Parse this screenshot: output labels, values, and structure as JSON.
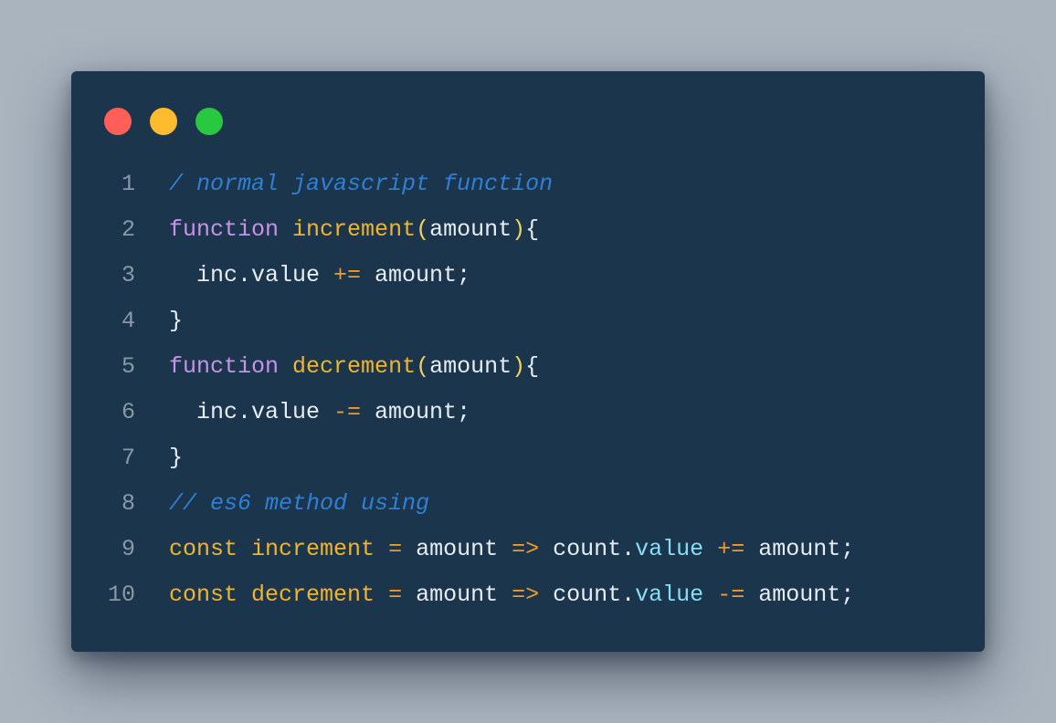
{
  "colors": {
    "page_background": "#a9b4bf",
    "window_background": "#1b364c",
    "close_dot": "#ff5f57",
    "minimize_dot": "#fdbc2e",
    "maximize_dot": "#28c840",
    "line_number": "#8a99a6",
    "comment": "#2f7fd6",
    "keyword": "#c792ea",
    "function_name": "#f0b52c",
    "operator": "#f19a2b",
    "paren": "#f0d264",
    "property": "#89ddf5",
    "plain": "#e6edf3"
  },
  "window_controls": [
    "close-dot",
    "minimize-dot",
    "maximize-dot"
  ],
  "code": {
    "language": "javascript",
    "lines": [
      {
        "number": "1",
        "tokens": [
          {
            "text": "/ normal javascript function",
            "type": "comment"
          }
        ]
      },
      {
        "number": "2",
        "tokens": [
          {
            "text": "function",
            "type": "keyword"
          },
          {
            "text": " ",
            "type": "plain"
          },
          {
            "text": "increment",
            "type": "fn"
          },
          {
            "text": "(",
            "type": "paren"
          },
          {
            "text": "amount",
            "type": "plain"
          },
          {
            "text": ")",
            "type": "paren"
          },
          {
            "text": "{",
            "type": "plain"
          }
        ]
      },
      {
        "number": "3",
        "tokens": [
          {
            "text": "  inc.value ",
            "type": "plain"
          },
          {
            "text": "+=",
            "type": "op"
          },
          {
            "text": " amount;",
            "type": "plain"
          }
        ]
      },
      {
        "number": "4",
        "tokens": [
          {
            "text": "}",
            "type": "plain"
          }
        ]
      },
      {
        "number": "5",
        "tokens": [
          {
            "text": "function",
            "type": "keyword"
          },
          {
            "text": " ",
            "type": "plain"
          },
          {
            "text": "decrement",
            "type": "fn"
          },
          {
            "text": "(",
            "type": "paren"
          },
          {
            "text": "amount",
            "type": "plain"
          },
          {
            "text": ")",
            "type": "paren"
          },
          {
            "text": "{",
            "type": "plain"
          }
        ]
      },
      {
        "number": "6",
        "tokens": [
          {
            "text": "  inc.value ",
            "type": "plain"
          },
          {
            "text": "-=",
            "type": "op"
          },
          {
            "text": " amount;",
            "type": "plain"
          }
        ]
      },
      {
        "number": "7",
        "tokens": [
          {
            "text": "}",
            "type": "plain"
          }
        ]
      },
      {
        "number": "8",
        "tokens": [
          {
            "text": "// es6 method using",
            "type": "comment"
          }
        ]
      },
      {
        "number": "9",
        "tokens": [
          {
            "text": "const",
            "type": "fn"
          },
          {
            "text": " ",
            "type": "plain"
          },
          {
            "text": "increment",
            "type": "fn"
          },
          {
            "text": " ",
            "type": "plain"
          },
          {
            "text": "=",
            "type": "op"
          },
          {
            "text": " amount ",
            "type": "plain"
          },
          {
            "text": "=>",
            "type": "op"
          },
          {
            "text": " count.",
            "type": "plain"
          },
          {
            "text": "value",
            "type": "prop"
          },
          {
            "text": " ",
            "type": "plain"
          },
          {
            "text": "+=",
            "type": "op"
          },
          {
            "text": " amount;",
            "type": "plain"
          }
        ]
      },
      {
        "number": "10",
        "tokens": [
          {
            "text": "const",
            "type": "fn"
          },
          {
            "text": " ",
            "type": "plain"
          },
          {
            "text": "decrement",
            "type": "fn"
          },
          {
            "text": " ",
            "type": "plain"
          },
          {
            "text": "=",
            "type": "op"
          },
          {
            "text": " amount ",
            "type": "plain"
          },
          {
            "text": "=>",
            "type": "op"
          },
          {
            "text": " count.",
            "type": "plain"
          },
          {
            "text": "value",
            "type": "prop"
          },
          {
            "text": " ",
            "type": "plain"
          },
          {
            "text": "-=",
            "type": "op"
          },
          {
            "text": " amount;",
            "type": "plain"
          }
        ]
      }
    ]
  }
}
